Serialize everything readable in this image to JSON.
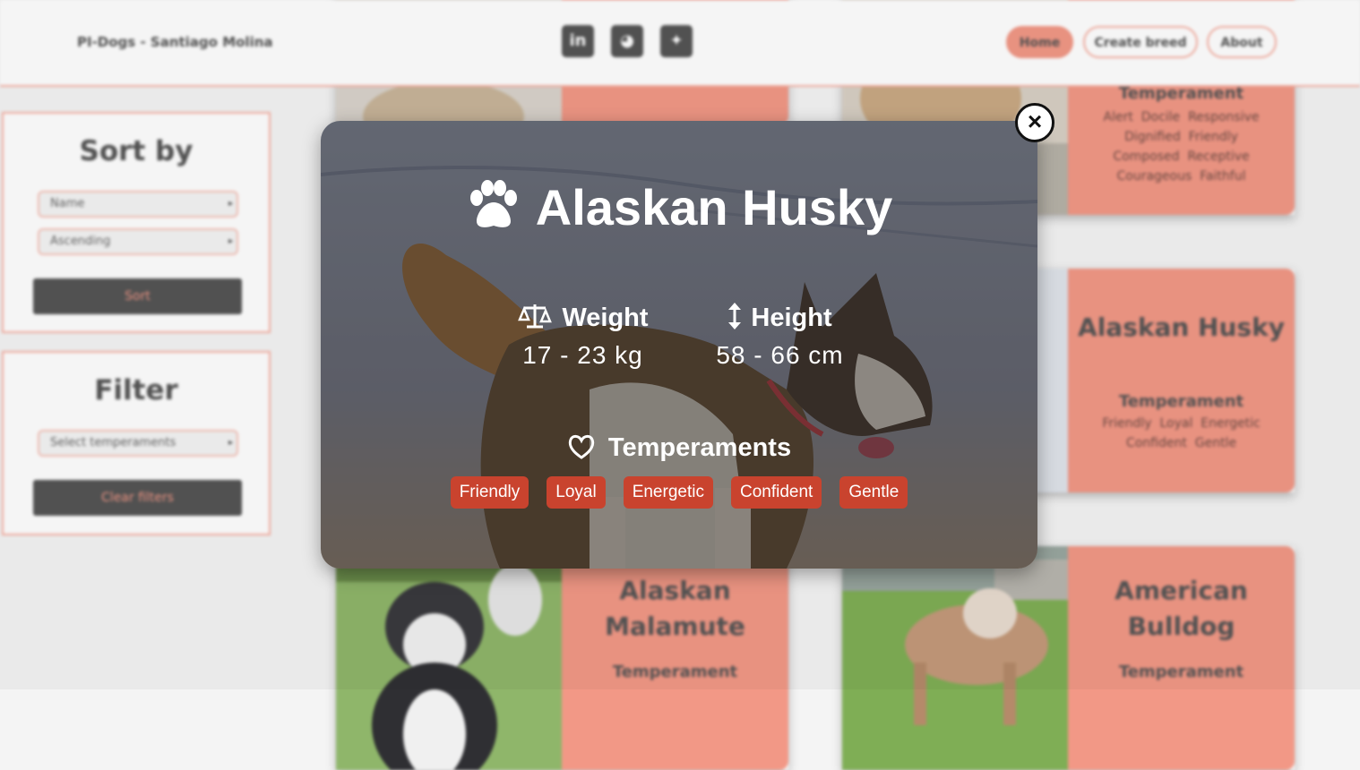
{
  "navbar": {
    "brand": "PI-Dogs - Santiago Molina",
    "social": [
      {
        "icon": "linkedin-icon",
        "glyph": "in"
      },
      {
        "icon": "github-icon",
        "glyph": "◕"
      },
      {
        "icon": "twitter-icon",
        "glyph": "✦"
      }
    ],
    "links": [
      "Home",
      "Create breed",
      "About"
    ]
  },
  "sort_panel": {
    "title": "Sort by",
    "select_field": "Name",
    "select_order": "Ascending",
    "button": "Sort"
  },
  "filter_panel": {
    "title": "Filter",
    "select_temperaments": "Select temperaments",
    "button": "Clear filters"
  },
  "cards": [
    {
      "name": "Temperament",
      "heading": "",
      "temperaments": [
        "Alert",
        "Docile",
        "Responsive",
        "Dignified",
        "Friendly",
        "Composed",
        "Receptive",
        "Courageous",
        "Faithful"
      ]
    },
    {
      "name": "Alaskan Husky",
      "heading": "Temperament",
      "temperaments": [
        "Friendly",
        "Loyal",
        "Energetic",
        "Confident",
        "Gentle"
      ]
    },
    {
      "name": "Alaskan Malamute",
      "heading": "Temperament",
      "temperaments": []
    },
    {
      "name": "American Bulldog",
      "heading": "Temperament",
      "temperaments": []
    }
  ],
  "modal": {
    "name": "Alaskan Husky",
    "weight_label": "Weight",
    "weight_value": "17 - 23 kg",
    "height_label": "Height",
    "height_value": "58 - 66 cm",
    "temperaments_label": "Temperaments",
    "temperaments": [
      "Friendly",
      "Loyal",
      "Energetic",
      "Confident",
      "Gentle"
    ],
    "close": "×"
  },
  "colors": {
    "accent": "#f29886",
    "chip": "#c9432e",
    "dark": "#555555"
  }
}
